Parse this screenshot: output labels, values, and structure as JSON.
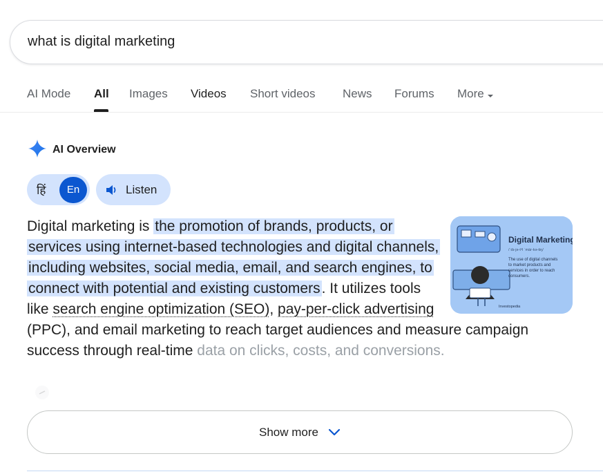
{
  "search": {
    "query": "what is digital marketing"
  },
  "tabs": [
    {
      "label": "AI Mode"
    },
    {
      "label": "All"
    },
    {
      "label": "Images"
    },
    {
      "label": "Videos"
    },
    {
      "label": "Short videos"
    },
    {
      "label": "News"
    },
    {
      "label": "Forums"
    },
    {
      "label": "More"
    }
  ],
  "ai_overview": {
    "title": "AI Overview",
    "lang_hindi": "हिं",
    "lang_english": "En",
    "listen_label": "Listen",
    "text": {
      "intro": "Digital marketing is ",
      "highlight": "the promotion of brands, products, or services using internet-based technologies and digital channels, including websites, social media, email, and search engines, to connect with potential and existing customers",
      "mid1": ". It utilizes tools like ",
      "link1": "search engine optimization (SEO)",
      "mid2": ", ",
      "link2": "pay-per-click advertising",
      "mid3": " (PPC), and email marketing to reach target audiences and measure campaign success through real-time ",
      "faded": "data on clicks, costs, and conversions."
    },
    "thumbnail": {
      "title": "Digital Marketing",
      "pronunciation": "/ˈdɪ-jə-tᵊl ˈmär-kə-tiŋ/",
      "description": "The use of digital channels to market products and services in order to reach consumers.",
      "brand": "Investopedia"
    },
    "show_more_label": "Show more"
  },
  "colors": {
    "accent_blue": "#0b57d0",
    "highlight": "#d3e3fd",
    "thumbnail_bg": "#a4c8f5"
  }
}
